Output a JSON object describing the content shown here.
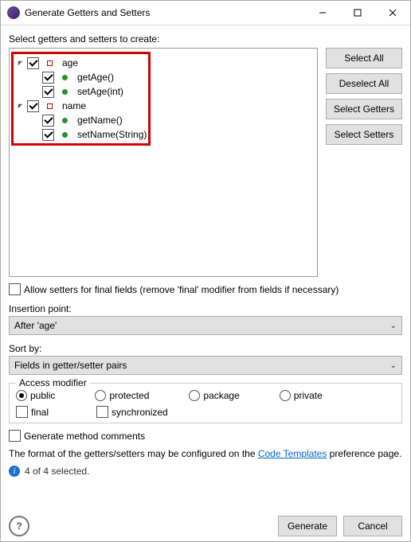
{
  "title": "Generate Getters and Setters",
  "instruction": "Select getters and setters to create:",
  "tree": {
    "fields": [
      {
        "name": "age",
        "methods": [
          "getAge()",
          "setAge(int)"
        ]
      },
      {
        "name": "name",
        "methods": [
          "getName()",
          "setName(String)"
        ]
      }
    ]
  },
  "buttons": {
    "select_all": "Select All",
    "deselect_all": "Deselect All",
    "select_getters": "Select Getters",
    "select_setters": "Select Setters"
  },
  "allow_final": "Allow setters for final fields (remove 'final' modifier from fields if necessary)",
  "insertion_label": "Insertion point:",
  "insertion_value": "After 'age'",
  "sort_label": "Sort by:",
  "sort_value": "Fields in getter/setter pairs",
  "access": {
    "title": "Access modifier",
    "public": "public",
    "protected": "protected",
    "package": "package",
    "private": "private",
    "final": "final",
    "synchronized": "synchronized"
  },
  "gen_comments": "Generate method comments",
  "format_pre": "The format of the getters/setters may be configured on the ",
  "format_link": "Code Templates",
  "format_post": " preference page.",
  "status": "4 of 4 selected.",
  "footer": {
    "generate": "Generate",
    "cancel": "Cancel"
  }
}
